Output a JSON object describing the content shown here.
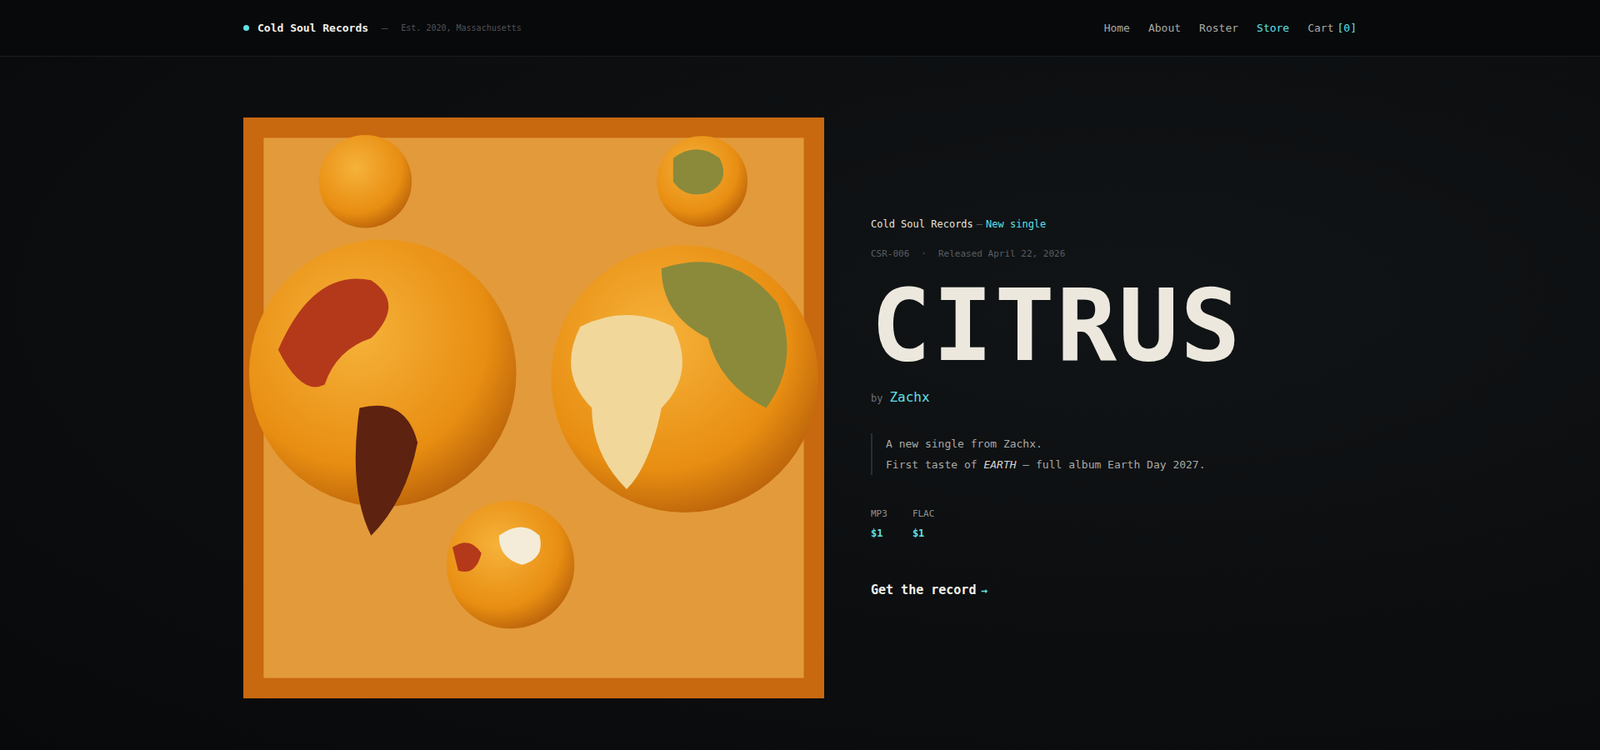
{
  "header": {
    "logo": "Cold Soul Records",
    "separator": "—",
    "tagline": "Est. 2020, Massachusetts"
  },
  "nav": [
    {
      "label": "Home",
      "selected": false
    },
    {
      "label": "About",
      "selected": false
    },
    {
      "label": "Roster",
      "selected": false
    },
    {
      "label": "Store",
      "selected": true
    }
  ],
  "cart": {
    "label": "Cart",
    "count": "[0]"
  },
  "release": {
    "eyebrow": {
      "label": "Cold Soul Records",
      "separator": "—",
      "type": "New single"
    },
    "meta": {
      "catalog": "CSR-006",
      "dot": "·",
      "released": "Released April 22, 2026"
    },
    "title": "CITRUS",
    "by": "by",
    "artist": "Zachx",
    "description": [
      [
        {
          "text": "A new single from Zachx.",
          "em": false
        }
      ],
      [
        {
          "text": "First taste of ",
          "em": false
        },
        {
          "text": "EARTH",
          "em": true
        },
        {
          "text": " — full album Earth Day 2027.",
          "em": false
        }
      ]
    ],
    "formats": [
      {
        "name": "MP3",
        "price": "$1"
      },
      {
        "name": "FLAC",
        "price": "$1"
      }
    ],
    "cta": {
      "label": "Get the record",
      "arrow": "→"
    }
  }
}
